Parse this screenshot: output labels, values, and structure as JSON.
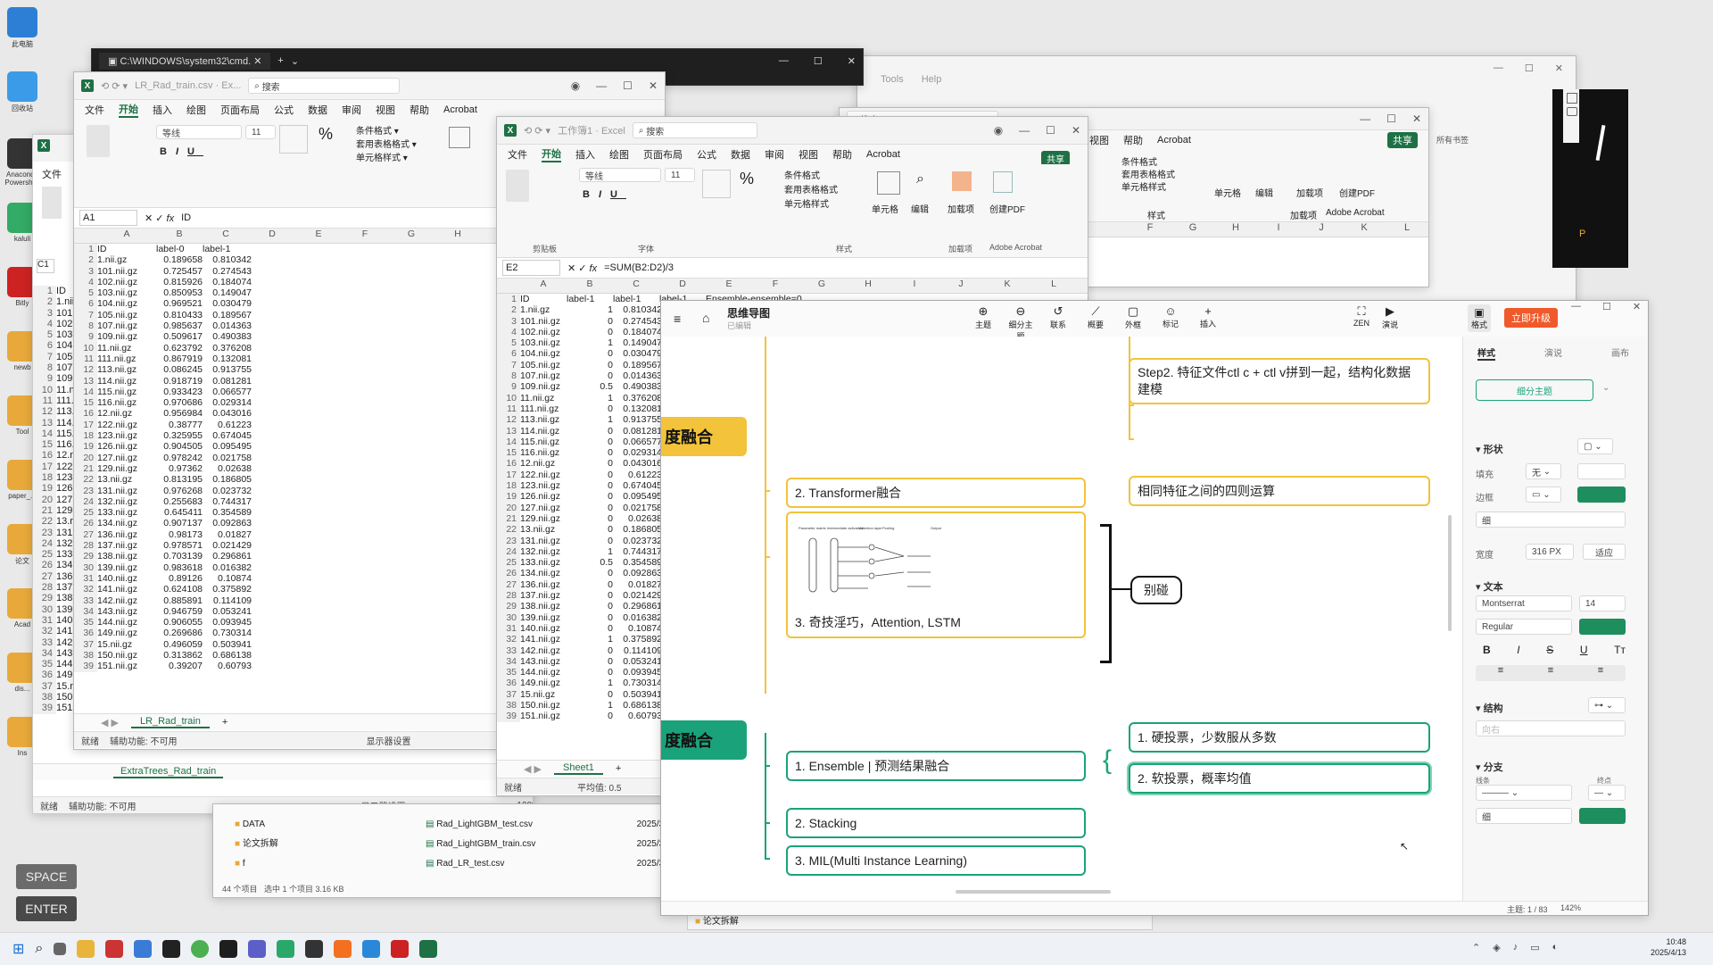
{
  "taskbar": {
    "time": "10:48",
    "date": "2025/4/13"
  },
  "keys": {
    "space": "SPACE",
    "enter": "ENTER"
  },
  "desktop_icons": [
    {
      "label": "此电脑",
      "color": "#2d7fd6"
    },
    {
      "label": "回收站",
      "color": "#3c9be8"
    },
    {
      "label": "Anaconda Powershell",
      "color": "#333"
    },
    {
      "label": "kaluli",
      "color": "#3a6"
    },
    {
      "label": "Bitly",
      "color": "#c22"
    },
    {
      "label": "newb",
      "color": "#e8a93a"
    },
    {
      "label": "Tool",
      "color": "#e8a93a"
    },
    {
      "label": "paper_...",
      "color": "#e8a93a"
    },
    {
      "label": "论文",
      "color": "#e8a93a"
    },
    {
      "label": "Acad",
      "color": "#e8a93a"
    },
    {
      "label": "dis...",
      "color": "#e8a93a"
    },
    {
      "label": "Ins",
      "color": "#e8a93a"
    }
  ],
  "cmd": {
    "title": "C:\\WINDOWS\\system32\\cmd."
  },
  "xl_back": {
    "title": "LR_Rad_train.csv",
    "namebox": "C1",
    "rows": [
      "ID",
      "1.nii.gz",
      "101.nii.gz",
      "102.nii.gz",
      "103.nii.gz",
      "104.nii.gz",
      "105.nii.gz",
      "107.nii.gz",
      "109.nii.gz",
      "11.nii.gz",
      "111.nii.gz",
      "113.nii.gz",
      "114.nii.gz",
      "115.nii.gz",
      "116.nii.gz",
      "12.nii.gz",
      "122.nii.gz",
      "123.nii.gz",
      "126.nii.gz",
      "127.nii.gz",
      "129.nii.gz",
      "13.nii.gz",
      "131.nii.gz",
      "132.nii.gz",
      "133.nii.gz",
      "134.nii.gz",
      "136.nii.gz",
      "137.nii.gz",
      "138.nii.gz",
      "139.nii.gz",
      "140.nii.gz",
      "141.nii.gz",
      "142.nii.gz",
      "143.nii.gz",
      "144.nii.gz",
      "149.nii.gz",
      "15.nii.gz",
      "150.nii.gz",
      "151.nii.gz"
    ],
    "sheet_tab": "ExtraTrees_Rad_train",
    "status_ready": "就绪",
    "status_access": "辅助功能: 不可用",
    "status_display": "显示器设置",
    "zoom": "100%"
  },
  "xl1": {
    "title": "LR_Rad_train.csv · Ex...",
    "search": "搜索",
    "menu": [
      "文件",
      "开始",
      "插入",
      "绘图",
      "页面布局",
      "公式",
      "数据",
      "审阅",
      "视图",
      "帮助",
      "Acrobat"
    ],
    "namebox": "A1",
    "formula": "ID",
    "font": "等线",
    "fontsize": "11",
    "cols": [
      "A",
      "B",
      "C",
      "D",
      "E",
      "F",
      "G",
      "H",
      "I"
    ],
    "headers": [
      "ID",
      "label-0",
      "label-1"
    ],
    "rows": [
      [
        "1.nii.gz",
        "0.189658",
        "0.810342"
      ],
      [
        "101.nii.gz",
        "0.725457",
        "0.274543"
      ],
      [
        "102.nii.gz",
        "0.815926",
        "0.184074"
      ],
      [
        "103.nii.gz",
        "0.850953",
        "0.149047"
      ],
      [
        "104.nii.gz",
        "0.969521",
        "0.030479"
      ],
      [
        "105.nii.gz",
        "0.810433",
        "0.189567"
      ],
      [
        "107.nii.gz",
        "0.985637",
        "0.014363"
      ],
      [
        "109.nii.gz",
        "0.509617",
        "0.490383"
      ],
      [
        "11.nii.gz",
        "0.623792",
        "0.376208"
      ],
      [
        "111.nii.gz",
        "0.867919",
        "0.132081"
      ],
      [
        "113.nii.gz",
        "0.086245",
        "0.913755"
      ],
      [
        "114.nii.gz",
        "0.918719",
        "0.081281"
      ],
      [
        "115.nii.gz",
        "0.933423",
        "0.066577"
      ],
      [
        "116.nii.gz",
        "0.970686",
        "0.029314"
      ],
      [
        "12.nii.gz",
        "0.956984",
        "0.043016"
      ],
      [
        "122.nii.gz",
        "0.38777",
        "0.61223"
      ],
      [
        "123.nii.gz",
        "0.325955",
        "0.674045"
      ],
      [
        "126.nii.gz",
        "0.904505",
        "0.095495"
      ],
      [
        "127.nii.gz",
        "0.978242",
        "0.021758"
      ],
      [
        "129.nii.gz",
        "0.97362",
        "0.02638"
      ],
      [
        "13.nii.gz",
        "0.813195",
        "0.186805"
      ],
      [
        "131.nii.gz",
        "0.976268",
        "0.023732"
      ],
      [
        "132.nii.gz",
        "0.255683",
        "0.744317"
      ],
      [
        "133.nii.gz",
        "0.645411",
        "0.354589"
      ],
      [
        "134.nii.gz",
        "0.907137",
        "0.092863"
      ],
      [
        "136.nii.gz",
        "0.98173",
        "0.01827"
      ],
      [
        "137.nii.gz",
        "0.978571",
        "0.021429"
      ],
      [
        "138.nii.gz",
        "0.703139",
        "0.296861"
      ],
      [
        "139.nii.gz",
        "0.983618",
        "0.016382"
      ],
      [
        "140.nii.gz",
        "0.89126",
        "0.10874"
      ],
      [
        "141.nii.gz",
        "0.624108",
        "0.375892"
      ],
      [
        "142.nii.gz",
        "0.885891",
        "0.114109"
      ],
      [
        "143.nii.gz",
        "0.946759",
        "0.053241"
      ],
      [
        "144.nii.gz",
        "0.906055",
        "0.093945"
      ],
      [
        "149.nii.gz",
        "0.269686",
        "0.730314"
      ],
      [
        "15.nii.gz",
        "0.496059",
        "0.503941"
      ],
      [
        "150.nii.gz",
        "0.313862",
        "0.686138"
      ],
      [
        "151.nii.gz",
        "0.39207",
        "0.60793"
      ]
    ],
    "sheet_tab": "LR_Rad_train",
    "status_ready": "就绪",
    "status_access": "辅助功能: 不可用",
    "status_display": "显示器设置"
  },
  "xl2": {
    "title": "工作簿1 · Excel",
    "search": "搜索",
    "share": "共享",
    "menu": [
      "文件",
      "开始",
      "插入",
      "绘图",
      "页面布局",
      "公式",
      "数据",
      "审阅",
      "视图",
      "帮助",
      "Acrobat"
    ],
    "namebox": "E2",
    "formula": "=SUM(B2:D2)/3",
    "font": "等线",
    "fontsize": "11",
    "ribbon_groups": [
      "剪贴板",
      "字体",
      "对齐方式",
      "数字",
      "样式",
      "单元格",
      "编辑",
      "加载项",
      "Adobe Acrobat"
    ],
    "ribbon_btns": [
      "条件格式",
      "套用表格格式",
      "单元格样式",
      "单元格",
      "编辑",
      "加载项",
      "创建PDF"
    ],
    "cols": [
      "A",
      "B",
      "C",
      "D",
      "E",
      "F",
      "G",
      "H",
      "I",
      "J",
      "K",
      "L"
    ],
    "headers": [
      "ID",
      "label-1",
      "label-1",
      "label-1",
      "Ensemble-ensemble=0"
    ],
    "row2": [
      "1.nii.gz",
      "1",
      "0.810342",
      "0.595436",
      "0.801926",
      "0.198074"
    ],
    "rows": [
      [
        "101.nii.gz",
        "0",
        "0.274543"
      ],
      [
        "102.nii.gz",
        "0",
        "0.184074"
      ],
      [
        "103.nii.gz",
        "1",
        "0.149047"
      ],
      [
        "104.nii.gz",
        "0",
        "0.030479"
      ],
      [
        "105.nii.gz",
        "0",
        "0.189567"
      ],
      [
        "107.nii.gz",
        "0",
        "0.014363"
      ],
      [
        "109.nii.gz",
        "0.5",
        "0.490383"
      ],
      [
        "11.nii.gz",
        "1",
        "0.376208"
      ],
      [
        "111.nii.gz",
        "0",
        "0.132081"
      ],
      [
        "113.nii.gz",
        "1",
        "0.913755"
      ],
      [
        "114.nii.gz",
        "0",
        "0.081281"
      ],
      [
        "115.nii.gz",
        "0",
        "0.066577"
      ],
      [
        "116.nii.gz",
        "0",
        "0.029314"
      ],
      [
        "12.nii.gz",
        "0",
        "0.043016"
      ],
      [
        "122.nii.gz",
        "0",
        "0.61223"
      ],
      [
        "123.nii.gz",
        "0",
        "0.674045"
      ],
      [
        "126.nii.gz",
        "0",
        "0.095495"
      ],
      [
        "127.nii.gz",
        "0",
        "0.021758"
      ],
      [
        "129.nii.gz",
        "0",
        "0.02638"
      ],
      [
        "13.nii.gz",
        "0",
        "0.186805"
      ],
      [
        "131.nii.gz",
        "0",
        "0.023732"
      ],
      [
        "132.nii.gz",
        "1",
        "0.744317"
      ],
      [
        "133.nii.gz",
        "0.5",
        "0.354589"
      ],
      [
        "134.nii.gz",
        "0",
        "0.092863"
      ],
      [
        "136.nii.gz",
        "0",
        "0.01827"
      ],
      [
        "137.nii.gz",
        "0",
        "0.021429"
      ],
      [
        "138.nii.gz",
        "0",
        "0.296861"
      ],
      [
        "139.nii.gz",
        "0",
        "0.016382"
      ],
      [
        "140.nii.gz",
        "0",
        "0.10874"
      ],
      [
        "141.nii.gz",
        "1",
        "0.375892"
      ],
      [
        "142.nii.gz",
        "0",
        "0.114109"
      ],
      [
        "143.nii.gz",
        "0",
        "0.053241"
      ],
      [
        "144.nii.gz",
        "0",
        "0.093945"
      ],
      [
        "149.nii.gz",
        "1",
        "0.730314"
      ],
      [
        "15.nii.gz",
        "0",
        "0.503941"
      ],
      [
        "150.nii.gz",
        "1",
        "0.686138"
      ],
      [
        "151.nii.gz",
        "0",
        "0.60793"
      ]
    ],
    "sheet_tab": "Sheet1",
    "status_ready": "就绪",
    "status_avg": "平均值: 0.5"
  },
  "explorer": {
    "folders": [
      "DATA",
      "论文拆解",
      "f"
    ],
    "files": [
      {
        "name": "Rad_LightGBM_test.csv",
        "date": "2025/3/"
      },
      {
        "name": "Rad_LightGBM_train.csv",
        "date": "2025/3/"
      },
      {
        "name": "Rad_LR_test.csv",
        "date": "2025/3/"
      }
    ],
    "status": "44 个项目",
    "status_sel": "选中 1 个项目  3.16 KB",
    "folder_bottom": "论文拆解"
  },
  "xl3": {
    "search": "搜索",
    "share": "共享",
    "menu": [
      "视图",
      "帮助",
      "Acrobat"
    ],
    "ribbon_btns": [
      "条件格式",
      "套用表格格式",
      "单元格样式",
      "单元格",
      "编辑",
      "加载项",
      "创建PDF"
    ],
    "groups": [
      "样式",
      "加载项",
      "Adobe Acrobat"
    ],
    "cols": [
      "F",
      "G",
      "H",
      "I",
      "J",
      "K",
      "L"
    ],
    "side": "所有书签"
  },
  "bg_window": {
    "menu": [
      "Tools",
      "Help"
    ]
  },
  "mindmap": {
    "app": "思维导图",
    "saved": "已编辑",
    "toolbar": [
      "主题",
      "细分主题",
      "联系",
      "概要",
      "外框",
      "标记",
      "插入"
    ],
    "right_btns": [
      "ZEN",
      "演说"
    ],
    "format_label": "格式",
    "upgrade": "立即升级",
    "panel_tabs": [
      "样式",
      "演说",
      "画布"
    ],
    "node_type": "细分主题",
    "sec_shape": "形状",
    "fill_label": "填充",
    "fill_value": "无",
    "border_label": "边框",
    "border_style": "细",
    "width_label": "宽度",
    "width_value": "316",
    "width_unit": "PX",
    "width_btn": "适应",
    "sec_text": "文本",
    "font": "Montserrat",
    "font_size": "14",
    "font_weight": "Regular",
    "sec_struct": "结构",
    "struct_value": "向右",
    "sec_branch": "分支",
    "branch_line": "线条",
    "branch_end": "终点",
    "branch_style": "细",
    "accent": "#1e8e5e",
    "status": "主题: 1 / 83",
    "zoom": "142%",
    "nodes": {
      "topic1": "度融合",
      "topic2": "度融合",
      "step2": "Step2. 特征文件ctl c + ctl v拼到一起，结构化数据建模",
      "arith": "相同特征之间的四则运算",
      "transformer": "2. Transformer融合",
      "tricks": "3. 奇技淫巧，Attention, LSTM",
      "bieping": "别碰",
      "ensemble": "1. Ensemble | 预测结果融合",
      "stacking": "2. Stacking",
      "mil": "3. MIL(Multi Instance Learning)",
      "hardvote": "1. 硬投票，少数服从多数",
      "softvote": "2. 软投票，概率均值"
    },
    "diagram_labels": [
      "Parameter matrix",
      "Intermediate activation",
      "Attention layer",
      "Pooling",
      "Output"
    ]
  }
}
